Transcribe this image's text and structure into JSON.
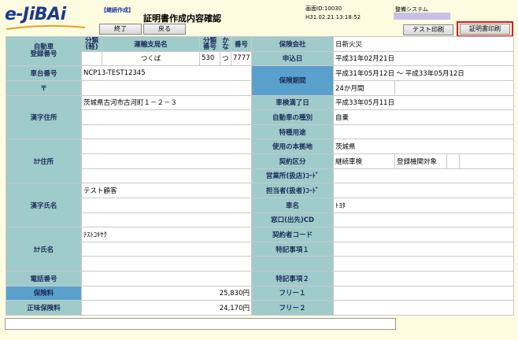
{
  "header": {
    "logo": "e-JiBAi",
    "mode_tag": "【継続作成】",
    "title": "証明書作成内容確認",
    "screen_id": "画面ID:10030",
    "timestamp": "H31.02.21 13:18:52",
    "system_name": "整備システム"
  },
  "buttons": {
    "end": "終了",
    "back": "戻る",
    "test_print": "テスト印刷",
    "cert_print": "証明書印刷"
  },
  "vehicle": {
    "reg_label": "自動車\n登録番号",
    "class_label": "分類(軽)",
    "branch_label": "運輸支局名",
    "classno_label": "分類番号",
    "kana_label": "かな",
    "number_label": "番号",
    "branch": "つくば",
    "classno": "530",
    "kana": "つ",
    "number": "7777",
    "chassis_label": "車台番号",
    "chassis": "NCP13-TEST12345"
  },
  "owner": {
    "postal_label": "〒",
    "kanji_address_label": "漢字住所",
    "kanji_address": "茨城県古河市古河町１－２－３",
    "kana_address_label": "ｶﾅ住所",
    "kanji_name_label": "漢字氏名",
    "kanji_name": "テスト顧客",
    "kana_name_label": "ｶﾅ氏名",
    "kana_name": "ﾃｽﾄｺｷﾔｸ",
    "phone_label": "電話番号"
  },
  "insurance": {
    "premium_label": "保険料",
    "premium": "25,830円",
    "net_premium_label": "正味保険料",
    "net_premium": "24,170円",
    "company_label": "保険会社",
    "company": "日新火災",
    "apply_date_label": "申込日",
    "apply_date": "平成31年02月21日",
    "period_label": "保険期間",
    "period": "平成31年05月12日 ～ 平成33年05月12日",
    "months": "24か月間",
    "inspection_label": "車検満了日",
    "inspection": "平成33年05月11日",
    "vehicle_type_label": "自動車の種別",
    "vehicle_type": "自乗",
    "special_use_label": "特種用途",
    "base_location_label": "使用の本拠地",
    "base_location": "茨城県",
    "contract_type_label": "契約区分",
    "contract_type": "継続車検",
    "contract_sub": "登録機関対象",
    "office_code_label": "営業所(扱店)ｺｰﾄﾞ",
    "agent_code_label": "担当者(扱者)ｺｰﾄﾞ",
    "car_name_label": "車名",
    "car_name": "ﾄﾖﾀ",
    "counter_label": "窓口(出先)CD",
    "contractor_code_label": "契約者コード",
    "note1_label": "特記事項１",
    "note2_label": "特記事項２",
    "free1_label": "フリー１",
    "free2_label": "フリー２"
  },
  "colors": {
    "label_bg": "#9fcbcb",
    "label_blue_bg": "#5aa0cc",
    "page_bg": "#fdfbe0",
    "highlight_border": "#e01818"
  }
}
